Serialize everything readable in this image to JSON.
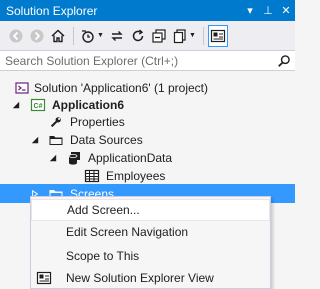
{
  "window": {
    "title": "Solution Explorer",
    "buttons": {
      "dropdown": "▾",
      "pin": "⊥",
      "close": "✕"
    }
  },
  "toolbar": {
    "items": [
      "back-icon",
      "forward-icon",
      "home-icon",
      "pending-changes-icon",
      "sync-icon",
      "refresh-icon",
      "collapse-all-icon",
      "copy-icon",
      "properties-icon",
      "preview-icon"
    ]
  },
  "search": {
    "placeholder": "Search Solution Explorer (Ctrl+;)",
    "value": ""
  },
  "tree": {
    "solution": "Solution 'Application6' (1 project)",
    "project": "Application6",
    "properties": "Properties",
    "data_sources": "Data Sources",
    "application_data": "ApplicationData",
    "employees": "Employees",
    "screens": "Screens"
  },
  "context_menu": {
    "items": [
      {
        "label": "Add Screen...",
        "icon": ""
      },
      {
        "label": "Edit Screen Navigation",
        "icon": ""
      },
      {
        "label": "Scope to This",
        "icon": ""
      },
      {
        "label": "New Solution Explorer View",
        "icon": "new-view-icon"
      }
    ]
  },
  "colors": {
    "titlebar": "#007acc",
    "selection": "#3399ff",
    "background": "#f5f5f5"
  }
}
